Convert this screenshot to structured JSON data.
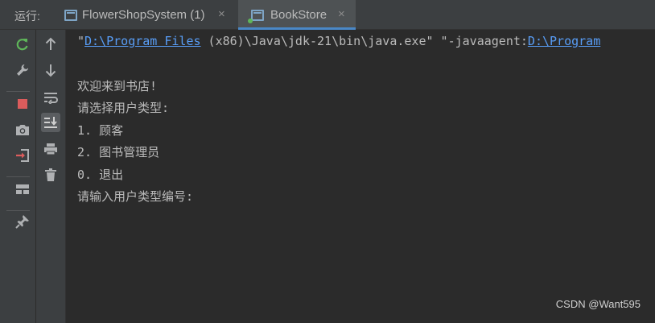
{
  "topbar": {
    "run_label": "运行:",
    "tabs": [
      {
        "label": "FlowerShopSystem (1)",
        "close": "×",
        "active": false
      },
      {
        "label": "BookStore",
        "close": "×",
        "active": true
      }
    ]
  },
  "toolbar_left": [
    {
      "icon": "rerun-icon"
    },
    {
      "icon": "wrench-icon"
    },
    {
      "icon": "stop-icon"
    },
    {
      "icon": "camera-icon"
    },
    {
      "icon": "exit-icon"
    },
    {
      "icon": "layout-icon"
    },
    {
      "icon": "pin-icon"
    }
  ],
  "toolbar_right": [
    {
      "icon": "arrow-up-icon"
    },
    {
      "icon": "arrow-down-icon"
    },
    {
      "icon": "soft-wrap-icon"
    },
    {
      "icon": "scroll-to-end-icon",
      "selected": true
    },
    {
      "icon": "print-icon"
    },
    {
      "icon": "trash-icon"
    }
  ],
  "console": {
    "cmd": {
      "q1": "\"",
      "link1": "D:\\Program Files",
      "mid": " (x86)\\Java\\jdk-21\\bin\\java.exe\" \"-javaagent:",
      "link2": "D:\\Program"
    },
    "lines": [
      "欢迎来到书店!",
      "请选择用户类型:",
      "1. 顾客",
      "2. 图书管理员",
      "0. 退出",
      "请输入用户类型编号:"
    ]
  },
  "watermark": "CSDN @Want595",
  "colors": {
    "link": "#589df6",
    "text": "#bbbbbb",
    "background": "#2b2b2b",
    "rerun": "#5fb65a",
    "stop": "#db5c5c",
    "tab_underline": "#4a88c7"
  }
}
